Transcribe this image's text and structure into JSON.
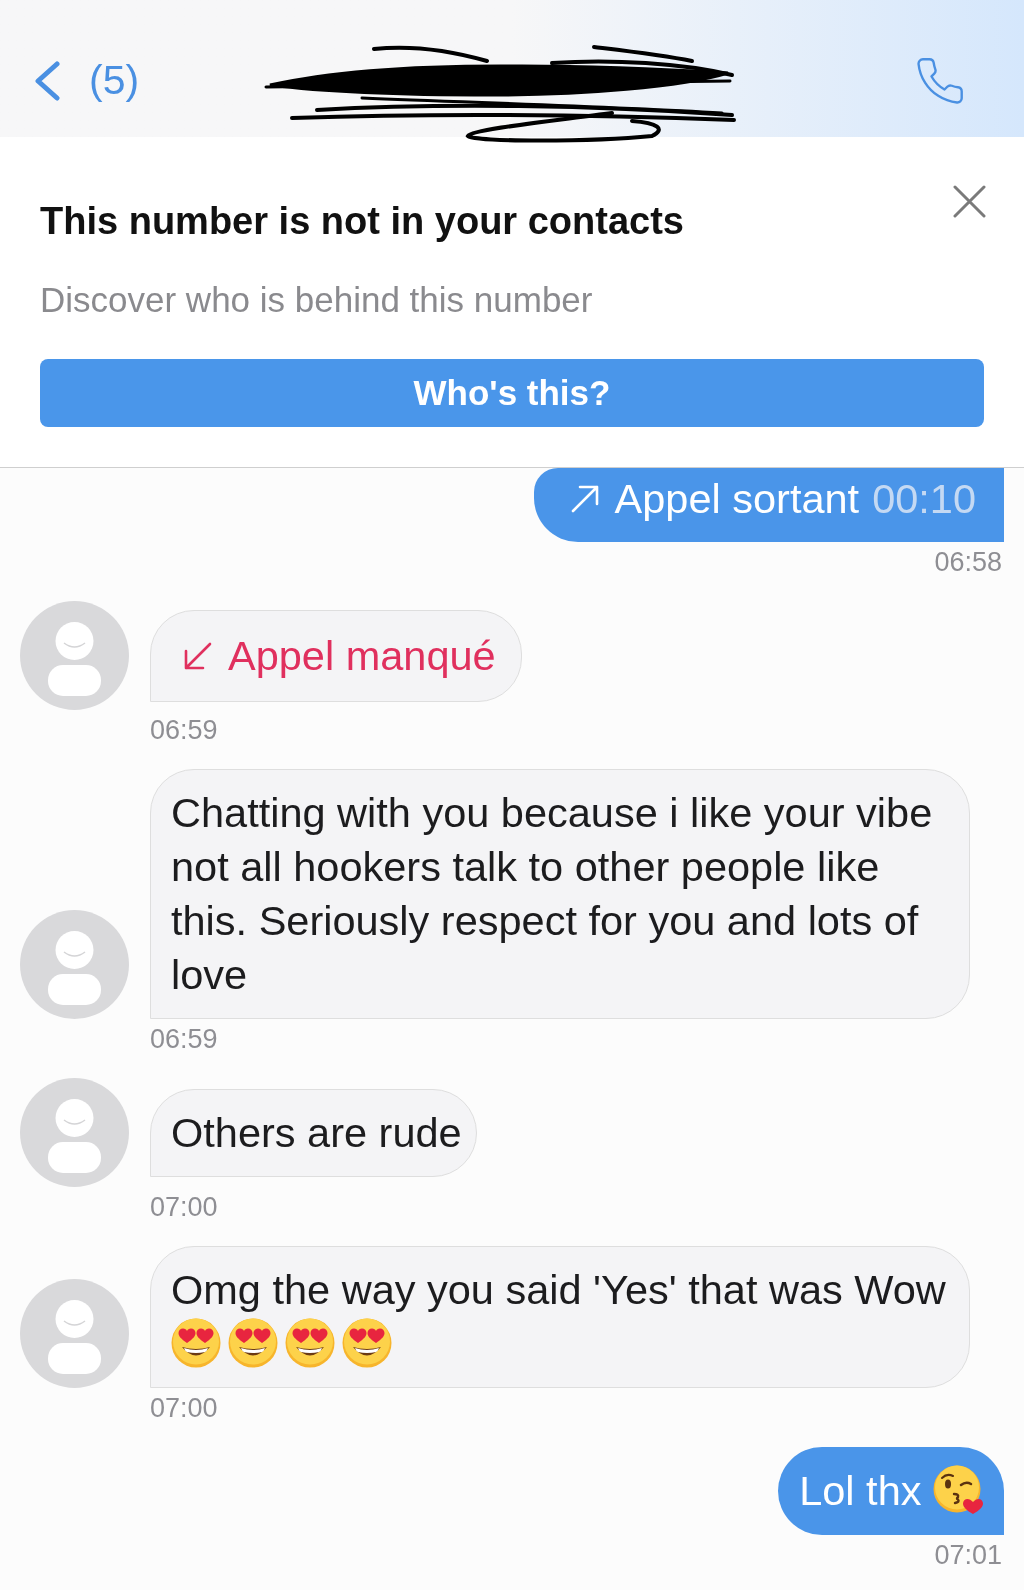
{
  "header": {
    "back_label": "(5)"
  },
  "banner": {
    "title": "This number is not in your contacts",
    "subtitle": "Discover who is behind this number",
    "button": "Who's this?"
  },
  "messages": [
    {
      "sent": true,
      "kind": "outgoing_call",
      "label": "Appel sortant",
      "duration": "00:10",
      "time": "06:58"
    },
    {
      "sent": false,
      "kind": "missed_call",
      "label": "Appel manqué",
      "time": "06:59"
    },
    {
      "sent": false,
      "kind": "text",
      "text": "Chatting with you because i like your vibe not all hookers talk to other people like this. Seriously respect for you and lots of love",
      "time": "06:59"
    },
    {
      "sent": false,
      "kind": "text",
      "text": "Others are rude",
      "time": "07:00"
    },
    {
      "sent": false,
      "kind": "text",
      "text": "Omg the way you said 'Yes' that was Wow",
      "emojis": [
        {
          "kind": "heart_eyes"
        },
        {
          "kind": "heart_eyes"
        },
        {
          "kind": "heart_eyes"
        },
        {
          "kind": "heart_eyes"
        }
      ],
      "time": "07:00"
    },
    {
      "sent": true,
      "kind": "text",
      "text": "Lol thx",
      "emojis": [
        {
          "kind": "kissing"
        }
      ],
      "time": "07:01"
    }
  ]
}
